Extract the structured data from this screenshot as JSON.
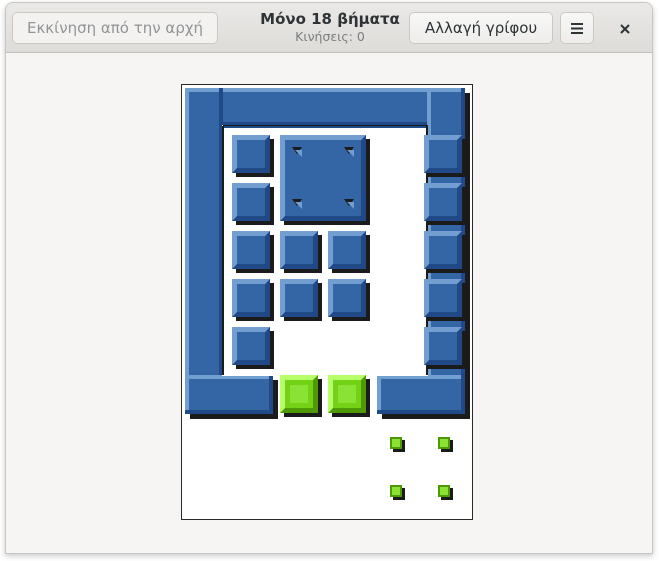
{
  "header": {
    "restart_label": "Εκκίνηση από την αρχή",
    "title": "Μόνο 18 βήματα",
    "moves_text": "Κινήσεις: 0",
    "change_puzzle_label": "Αλλαγή γρίφου",
    "menu_icon": "hamburger-menu-icon",
    "close_icon": "close-icon"
  },
  "colors": {
    "wall": "#3465a4",
    "wall_light": "#729fcf",
    "wall_dark": "#204a87",
    "target_piece": "#73d216",
    "target_light": "#b6ff6a",
    "target_dark": "#4e9a06"
  }
}
